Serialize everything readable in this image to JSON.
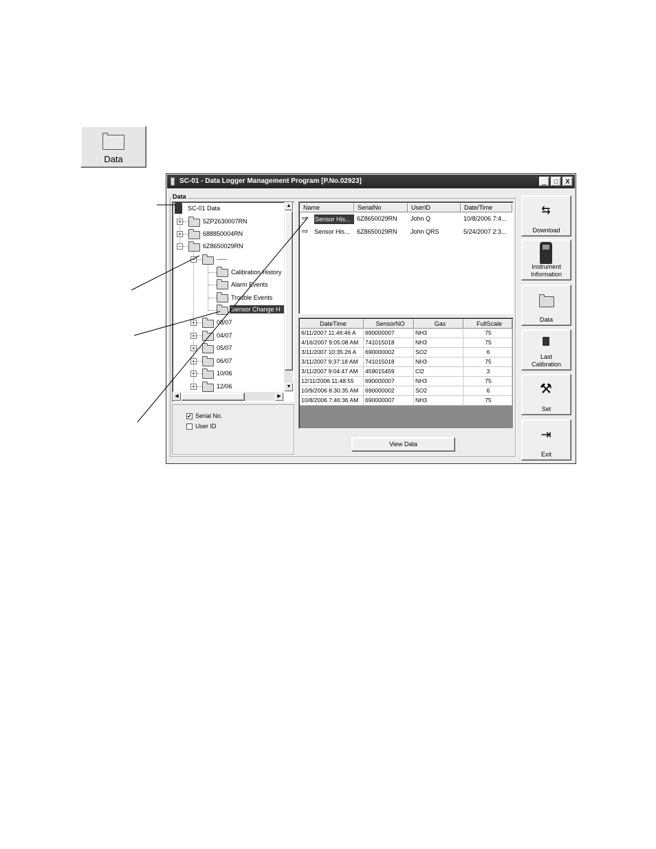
{
  "big_button": {
    "label": "Data",
    "icon": "folder-icon"
  },
  "window": {
    "title": "SC-01 - Data Logger Management Program [P.No.02923]",
    "controls": [
      "_",
      "□",
      "X"
    ]
  },
  "groupbox": {
    "label": "Data"
  },
  "tree": {
    "root": "SC-01 Data",
    "items": [
      "5ZP2630007RN",
      "688850004RN",
      "6Z8650029RN",
      "-----",
      "Calibration History",
      "Alarm Events",
      "Trouble Events",
      "Sensor Change H",
      "03/07",
      "04/07",
      "05/07",
      "06/07",
      "10/06",
      "12/06"
    ]
  },
  "options": {
    "serial_no": "Serial No.",
    "user_id": "User ID",
    "serial_checked": true,
    "user_checked": false
  },
  "file_list": {
    "headers": [
      "Name",
      "SerialNo",
      "UserID",
      "Date/Time"
    ],
    "rows": [
      [
        "Sensor His...",
        "6Z8650029RN",
        "John Q",
        "10/8/2006 7:4..."
      ],
      [
        "Sensor His...",
        "6Z8650029RN",
        "John QRS",
        "5/24/2007 2:3..."
      ]
    ]
  },
  "data_table": {
    "headers": [
      "DateTime",
      "SensorNO",
      "Gas",
      "FullScale"
    ],
    "rows": [
      [
        "6/11/2007 11:46:46 A",
        "690000007",
        "NH3",
        "75"
      ],
      [
        "4/16/2007 9:05:08 AM",
        "741015018",
        "NH3",
        "75"
      ],
      [
        "3/11/2007 10:35:26 A",
        "690000002",
        "SO2",
        "6"
      ],
      [
        "3/11/2007 9:37:18 AM",
        "741015018",
        "NH3",
        "75"
      ],
      [
        "3/11/2007 9:04:47 AM",
        "459015459",
        "Cl2",
        "3"
      ],
      [
        "12/11/2006 11:48:55",
        "690000007",
        "NH3",
        "75"
      ],
      [
        "10/9/2006 8:30:35 AM",
        "690000002",
        "SO2",
        "6"
      ],
      [
        "10/8/2006 7:46:36 AM",
        "690000007",
        "NH3",
        "75"
      ]
    ]
  },
  "view_data_button": "View Data",
  "side_buttons": {
    "download": "Download",
    "instrument_line1": "Instrument",
    "instrument_line2": "Information",
    "data": "Data",
    "last_cal_line1": "Last",
    "last_cal_line2": "Calibration",
    "set": "Set",
    "exit": "Exit"
  }
}
